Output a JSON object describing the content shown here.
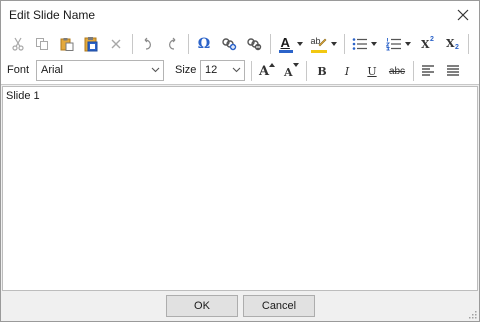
{
  "window": {
    "title": "Edit Slide Name"
  },
  "toolbar": {
    "font_label": "Font",
    "font_value": "Arial",
    "size_label": "Size",
    "size_value": "12",
    "omega_glyph": "Ω",
    "font_color_glyph": "A",
    "font_color": "#2b63c9",
    "highlight_color": "#f2c811",
    "grow_glyph": "A",
    "shrink_glyph": "A",
    "bold_glyph": "B",
    "italic_glyph": "I",
    "underline_glyph": "U",
    "strike_glyph": "abc",
    "superscript_glyph": "X",
    "superscript_mark": "2",
    "subscript_glyph": "X",
    "subscript_mark": "2"
  },
  "icons": [
    "cut-icon",
    "copy-icon",
    "paste-icon",
    "paste-special-icon",
    "delete-icon",
    "undo-icon",
    "redo-icon",
    "symbol-icon",
    "insert-link-icon",
    "remove-link-icon",
    "font-color-icon",
    "highlight-icon",
    "bullets-icon",
    "numbering-icon",
    "superscript-icon",
    "subscript-icon",
    "grow-font-icon",
    "shrink-font-icon",
    "bold-icon",
    "italic-icon",
    "underline-icon",
    "strikethrough-icon",
    "align-left-icon",
    "justify-icon",
    "close-icon",
    "resize-grip-icon"
  ],
  "editor": {
    "text": "Slide 1"
  },
  "footer": {
    "ok_label": "OK",
    "cancel_label": "Cancel"
  }
}
